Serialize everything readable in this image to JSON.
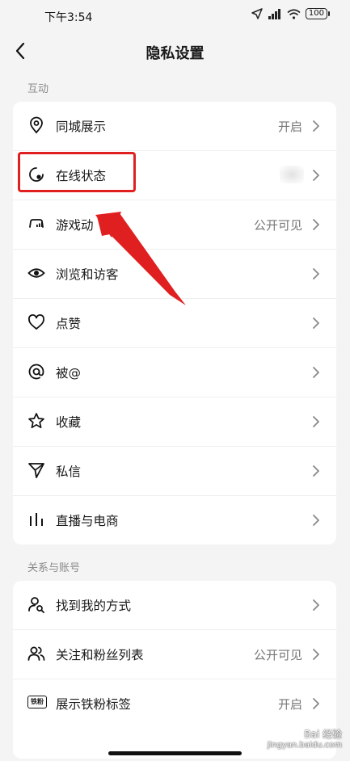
{
  "status_bar": {
    "time": "下午3:54",
    "battery": "100"
  },
  "header": {
    "title": "隐私设置"
  },
  "sections": [
    {
      "title": "互动",
      "items": [
        {
          "icon": "location-pin-icon",
          "label": "同城展示",
          "value": "开启"
        },
        {
          "icon": "online-status-icon",
          "label": "在线状态",
          "value": ""
        },
        {
          "icon": "game-controller-icon",
          "label": "游戏动",
          "value": "公开可见"
        },
        {
          "icon": "eye-icon",
          "label": "浏览和访客",
          "value": ""
        },
        {
          "icon": "heart-icon",
          "label": "点赞",
          "value": ""
        },
        {
          "icon": "at-sign-icon",
          "label": "被@",
          "value": ""
        },
        {
          "icon": "star-icon",
          "label": "收藏",
          "value": ""
        },
        {
          "icon": "paper-plane-icon",
          "label": "私信",
          "value": ""
        },
        {
          "icon": "bar-chart-icon",
          "label": "直播与电商",
          "value": ""
        }
      ]
    },
    {
      "title": "关系与账号",
      "items": [
        {
          "icon": "find-user-icon",
          "label": "找到我的方式",
          "value": ""
        },
        {
          "icon": "users-icon",
          "label": "关注和粉丝列表",
          "value": "公开可见"
        },
        {
          "icon": "fan-badge-icon",
          "label": "展示铁粉标签",
          "value": "开启"
        }
      ]
    }
  ],
  "fan_badge_text": "铁粉",
  "watermark": {
    "line1": "Bai 经验",
    "line2": "jingyan.baidu.com"
  },
  "colors": {
    "highlight": "#e02020",
    "background": "#f4f4f5",
    "card": "#ffffff"
  }
}
